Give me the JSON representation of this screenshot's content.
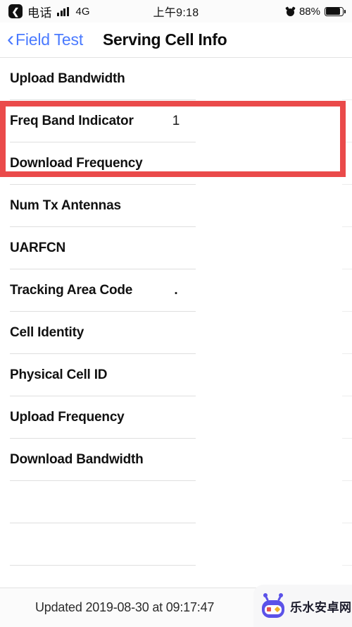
{
  "status_bar": {
    "back_chip_icon": "chevron-left-icon",
    "carrier": "电话",
    "signal_icon": "signal-bars-icon",
    "network": "4G",
    "time": "上午9:18",
    "alarm_icon": "alarm-clock-icon",
    "battery_percent": "88%",
    "battery_icon": "battery-icon"
  },
  "nav_bar": {
    "back_icon": "chevron-left-icon",
    "back_label": "Field Test",
    "title": "Serving Cell Info",
    "accent_color": "#4a7aff"
  },
  "list": {
    "rows": [
      {
        "label": "Upload Bandwidth",
        "value": ""
      },
      {
        "label": "Freq Band Indicator",
        "value": "1"
      },
      {
        "label": "Download Frequency",
        "value": ""
      },
      {
        "label": "Num Tx Antennas",
        "value": ""
      },
      {
        "label": "UARFCN",
        "value": ""
      },
      {
        "label": "Tracking Area Code",
        "value": "."
      },
      {
        "label": "Cell Identity",
        "value": ""
      },
      {
        "label": "Physical Cell ID",
        "value": ""
      },
      {
        "label": "Upload Frequency",
        "value": ""
      },
      {
        "label": "Download Bandwidth",
        "value": ""
      },
      {
        "label": "",
        "value": ""
      },
      {
        "label": "",
        "value": ""
      },
      {
        "label": "",
        "value": ""
      }
    ]
  },
  "highlight": {
    "color": "#ea4a4a",
    "covers": [
      "Freq Band Indicator",
      "Download Frequency"
    ]
  },
  "footer": {
    "updated_text": "Updated 2019-08-30 at 09:17:47"
  },
  "watermark": {
    "text": "乐水安卓网",
    "icon": "robot-icon",
    "color": "#5b52e8"
  }
}
